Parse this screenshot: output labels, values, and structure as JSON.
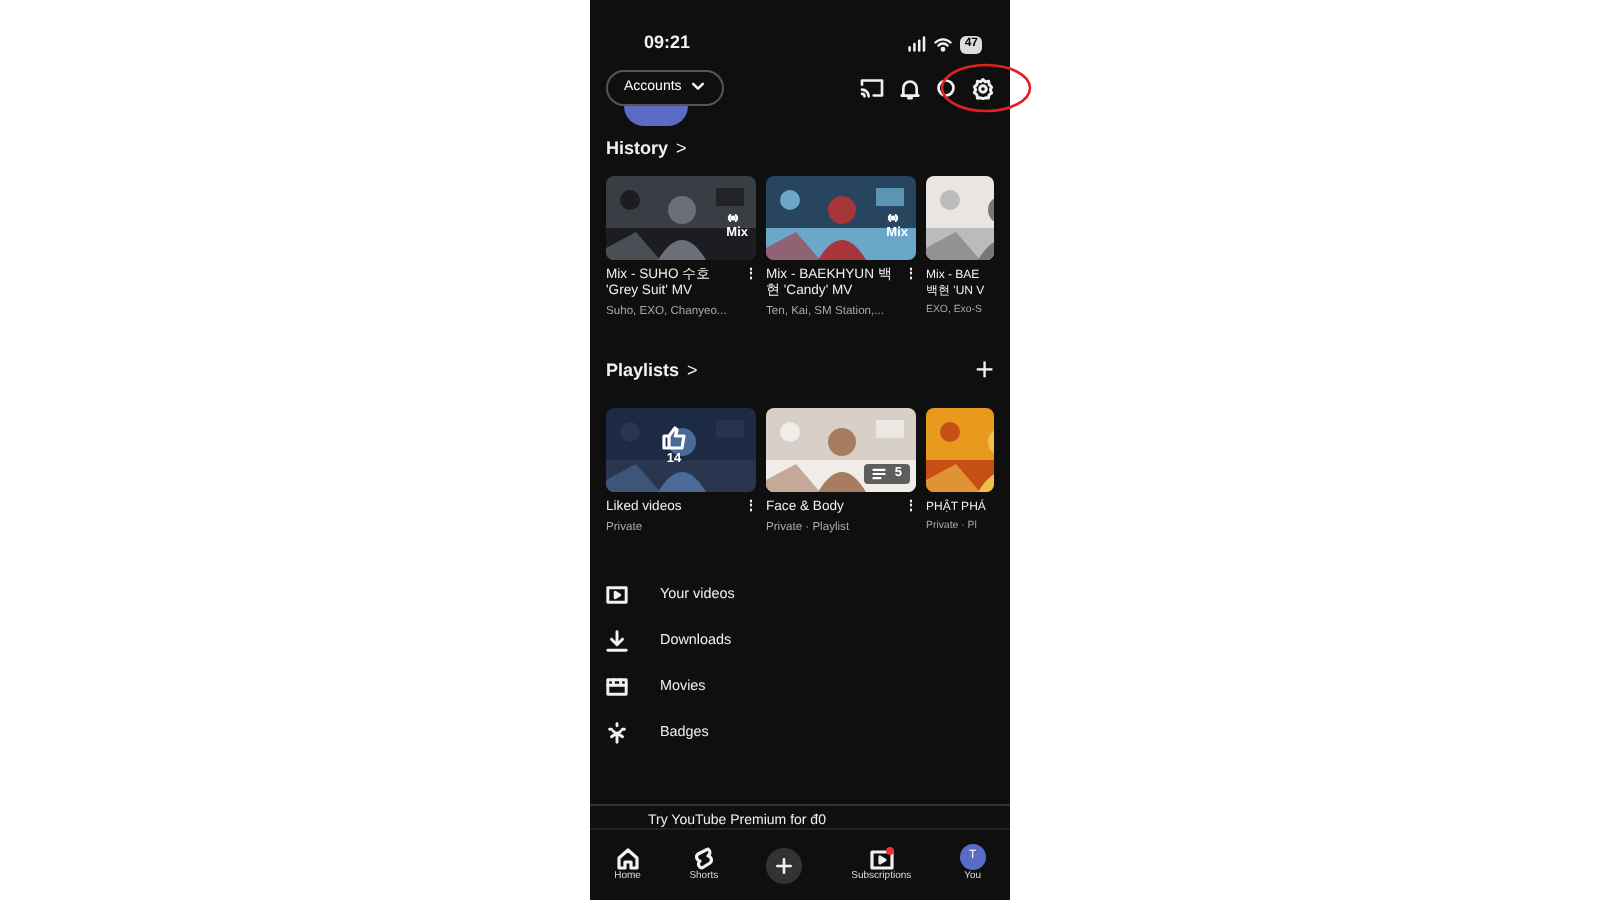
{
  "status_bar": {
    "time": "09:21",
    "battery": "47"
  },
  "header": {
    "accounts_button": "Accounts"
  },
  "history": {
    "title": "History",
    "chevron": ">",
    "items": [
      {
        "title": "Mix - SUHO 수호 'Grey Suit' MV",
        "subtitle": "Suho, EXO, Chanyeo...",
        "badge": "Mix",
        "menu": "⋮"
      },
      {
        "title": "Mix - BAEKHYUN 백현 'Candy' MV",
        "subtitle": "Ten, Kai, SM Station,...",
        "badge": "Mix",
        "menu": "⋮"
      },
      {
        "title": "Mix - BAE 백현 'UN V",
        "subtitle": "EXO, Exo-S"
      }
    ]
  },
  "playlists": {
    "title": "Playlists",
    "chevron": ">",
    "add": "+",
    "items": [
      {
        "title": "Liked videos",
        "subtitle": "Private",
        "count": "14",
        "kind": "liked",
        "menu": "⋮"
      },
      {
        "title": "Face & Body",
        "subtitle": "Private · Playlist",
        "count": "5",
        "kind": "list",
        "menu": "⋮"
      },
      {
        "title": "PHẬT PHÁ",
        "subtitle": "Private · Pl",
        "kind": "plain"
      }
    ]
  },
  "menu": [
    {
      "kind": "videos",
      "label": "Your videos"
    },
    {
      "kind": "download",
      "label": "Downloads"
    },
    {
      "kind": "movies",
      "label": "Movies"
    },
    {
      "kind": "badges",
      "label": "Badges"
    }
  ],
  "premium_banner": "Try YouTube Premium for đ0",
  "bottom_nav": [
    {
      "kind": "home",
      "label": "Home"
    },
    {
      "kind": "shorts",
      "label": "Shorts"
    },
    {
      "kind": "create"
    },
    {
      "kind": "subscriptions",
      "label": "Subscriptions"
    },
    {
      "kind": "you",
      "label": "You",
      "avatar": "T"
    }
  ]
}
